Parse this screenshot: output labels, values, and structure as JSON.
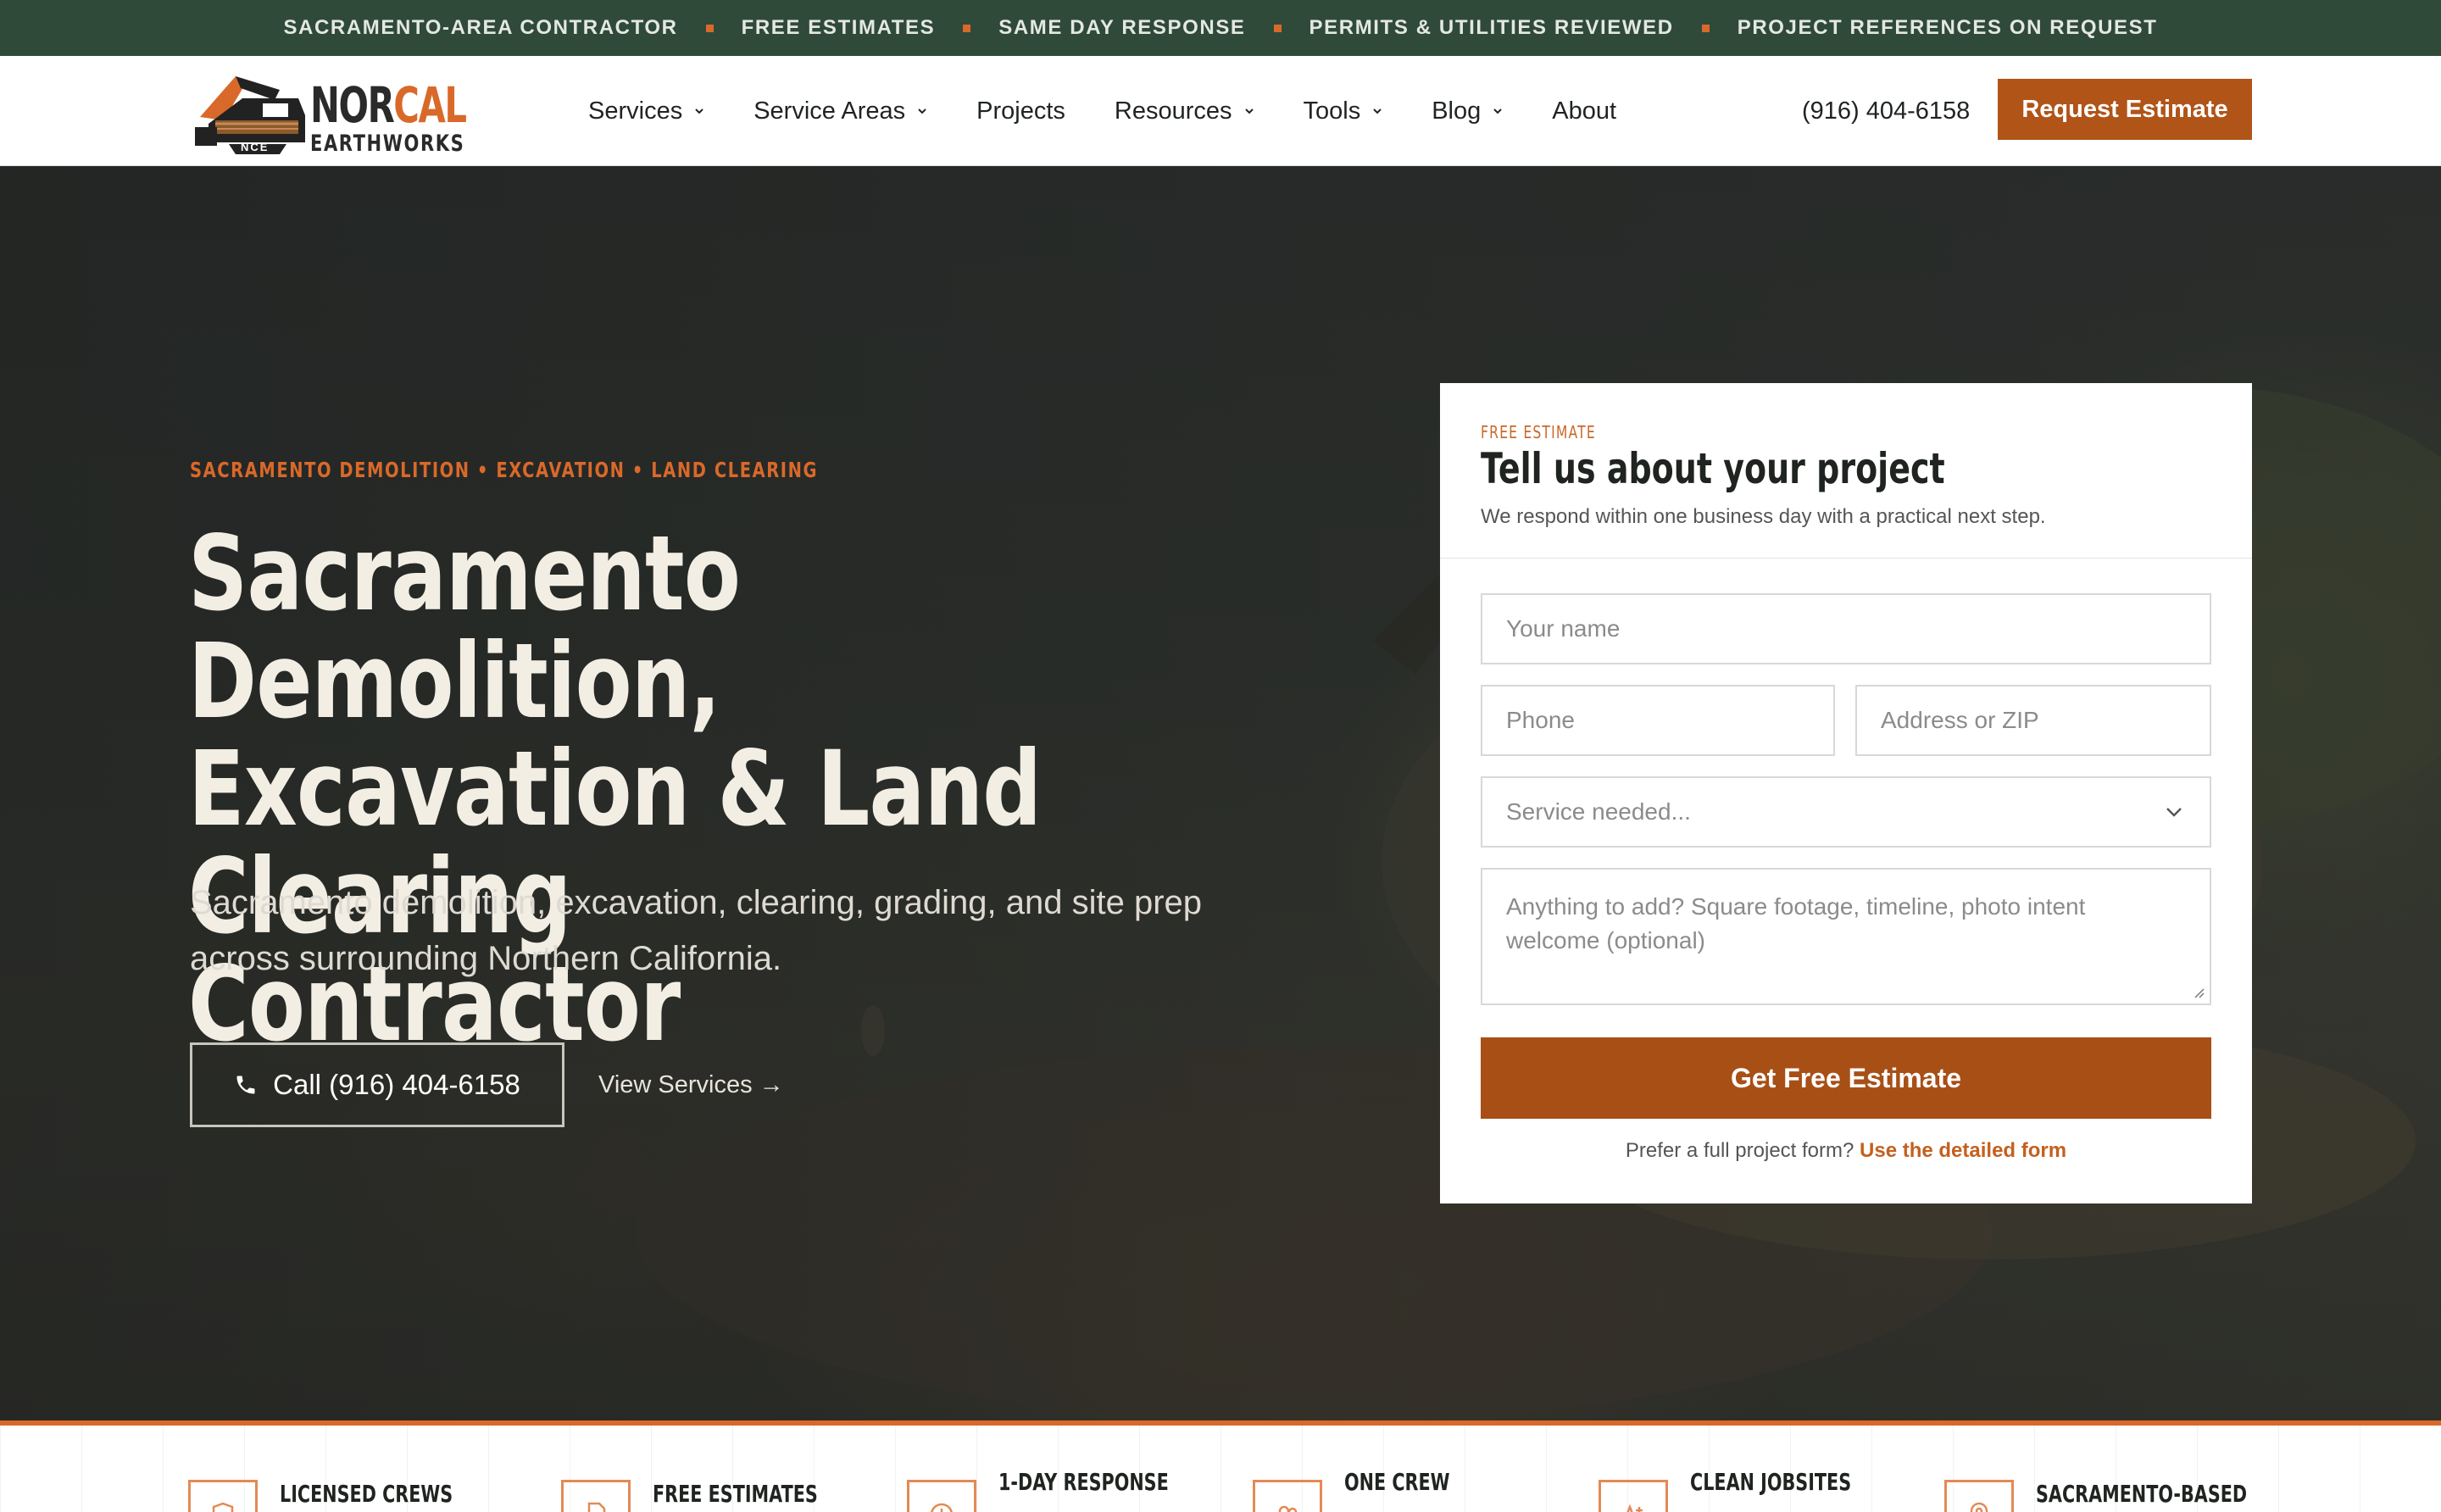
{
  "topbar": {
    "items": [
      "SACRAMENTO-AREA CONTRACTOR",
      "FREE ESTIMATES",
      "SAME DAY RESPONSE",
      "PERMITS & UTILITIES REVIEWED",
      "PROJECT REFERENCES ON REQUEST"
    ]
  },
  "brand": {
    "name_nor": "NOR",
    "name_cal": "CAL",
    "name_sub": "EARTHWORKS",
    "badge": "NCE",
    "accent": "#d9692a",
    "dark": "#2f4a38"
  },
  "nav": {
    "items": [
      {
        "label": "Services",
        "icon": "chevron-down-icon"
      },
      {
        "label": "Service Areas",
        "icon": "chevron-down-icon"
      },
      {
        "label": "Projects"
      },
      {
        "label": "Resources",
        "icon": "chevron-down-icon"
      },
      {
        "label": "Tools",
        "icon": "chevron-down-icon"
      },
      {
        "label": "Blog",
        "icon": "chevron-down-icon"
      },
      {
        "label": "About"
      }
    ],
    "phone": "(916) 404-6158",
    "cta": "Request Estimate"
  },
  "hero": {
    "eyebrow": "SACRAMENTO DEMOLITION • EXCAVATION • LAND CLEARING",
    "title_line1": "Sacramento Demolition,",
    "title_line2": "Excavation & Land Clearing",
    "title_line3": "Contractor",
    "subtitle": "Sacramento demolition, excavation, clearing, grading, and site prep across surrounding Northern California.",
    "call_label": "Call (916) 404-6158",
    "view_label": "View Services →"
  },
  "form": {
    "tag": "FREE ESTIMATE",
    "title": "Tell us about your project",
    "subtitle": "We respond within one business day with a practical next step.",
    "name_placeholder": "Your name",
    "phone_placeholder": "Phone",
    "address_placeholder": "Address or ZIP",
    "service_placeholder": "Service needed...",
    "notes_placeholder": "Anything to add? Square footage, timeline, photo intent welcome (optional)",
    "submit_label": "Get Free Estimate",
    "alt_text": "Prefer a full project form?",
    "alt_link": "Use the detailed form"
  },
  "trust": {
    "items": [
      {
        "label": "LICENSED CREWS",
        "icon": "shield-icon"
      },
      {
        "label": "FREE ESTIMATES",
        "icon": "document-icon"
      },
      {
        "label": "1-DAY RESPONSE",
        "icon": "clock-icon"
      },
      {
        "label": "ONE CREW",
        "icon": "team-icon"
      },
      {
        "label": "CLEAN JOBSITES",
        "icon": "rating-icon"
      },
      {
        "label": "SACRAMENTO-BASED",
        "icon": "location-icon"
      }
    ]
  }
}
